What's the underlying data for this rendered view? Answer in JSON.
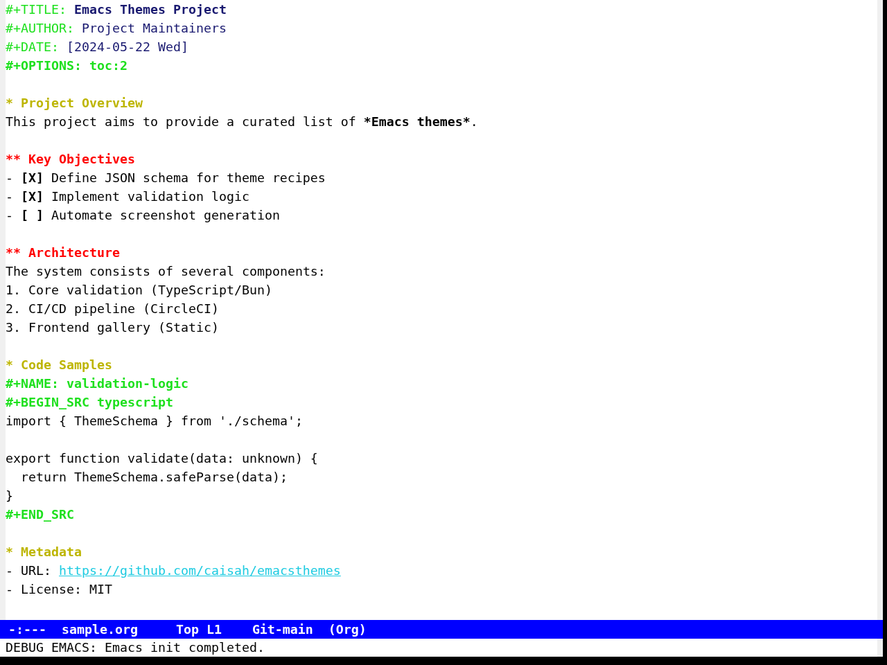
{
  "buffer": {
    "keywords": [
      {
        "key": "#+TITLE:",
        "value": "Emacs Themes Project",
        "kind": "title"
      },
      {
        "key": "#+AUTHOR:",
        "value": "Project Maintainers",
        "kind": "meta"
      },
      {
        "key": "#+DATE:",
        "value": "[2024-05-22 Wed]",
        "kind": "meta"
      },
      {
        "key": "#+OPTIONS:",
        "value": "toc:2",
        "kind": "setting"
      }
    ],
    "sections": [
      {
        "heading": "* Project Overview",
        "body": [
          {
            "kind": "paragraph",
            "segments": [
              {
                "text": "This project aims to provide a curated list of ",
                "bold": false
              },
              {
                "text": "*Emacs themes*",
                "bold": true
              },
              {
                "text": ".",
                "bold": false
              }
            ]
          }
        ],
        "children": [
          {
            "heading": "** Key Objectives",
            "body": [
              {
                "kind": "checkbox",
                "bullet": "-",
                "checkbox": "[X]",
                "text": "Define JSON schema for theme recipes"
              },
              {
                "kind": "checkbox",
                "bullet": "-",
                "checkbox": "[X]",
                "text": "Implement validation logic"
              },
              {
                "kind": "checkbox",
                "bullet": "-",
                "checkbox": "[ ]",
                "text": "Automate screenshot generation"
              }
            ]
          },
          {
            "heading": "** Architecture",
            "body": [
              {
                "kind": "line",
                "text": "The system consists of several components:"
              },
              {
                "kind": "line",
                "text": "1. Core validation (TypeScript/Bun)"
              },
              {
                "kind": "line",
                "text": "2. CI/CD pipeline (CircleCI)"
              },
              {
                "kind": "line",
                "text": "3. Frontend gallery (Static)"
              }
            ]
          }
        ]
      },
      {
        "heading": "* Code Samples",
        "body": [
          {
            "kind": "directive",
            "text": "#+NAME: validation-logic"
          },
          {
            "kind": "directive",
            "text": "#+BEGIN_SRC typescript"
          },
          {
            "kind": "code",
            "text": "import { ThemeSchema } from './schema';"
          },
          {
            "kind": "blank"
          },
          {
            "kind": "code",
            "text": "export function validate(data: unknown) {"
          },
          {
            "kind": "code",
            "text": "  return ThemeSchema.safeParse(data);"
          },
          {
            "kind": "code",
            "text": "}"
          },
          {
            "kind": "directive",
            "text": "#+END_SRC"
          }
        ]
      },
      {
        "heading": "* Metadata",
        "body": [
          {
            "kind": "link",
            "text": "- URL:",
            "link": "https://github.com/caisah/emacsthemes"
          },
          {
            "kind": "line",
            "text": "- License: MIT"
          }
        ]
      }
    ]
  },
  "mode_line": {
    "status": "-:---",
    "buffer_name": "sample.org",
    "position": "Top L1",
    "branch": "Git-main",
    "major_mode": "(Org)"
  },
  "echo_area": {
    "message": "DEBUG EMACS: Emacs init completed."
  }
}
